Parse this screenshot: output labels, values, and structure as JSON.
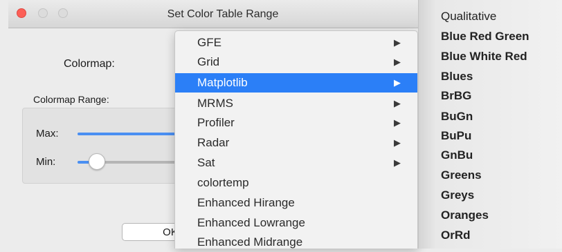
{
  "window": {
    "title": "Set Color Table Range"
  },
  "dialog": {
    "colormap_label": "Colormap:",
    "range_label": "Colormap Range:",
    "max_label": "Max:",
    "min_label": "Min:",
    "ok_label": "OK",
    "max_slider_level": 1.0,
    "min_slider_level": 0.1
  },
  "menu": {
    "items": [
      {
        "label": "GFE",
        "submenu": true
      },
      {
        "label": "Grid",
        "submenu": true
      },
      {
        "label": "Matplotlib",
        "submenu": true,
        "selected": true
      },
      {
        "label": "MRMS",
        "submenu": true
      },
      {
        "label": "Profiler",
        "submenu": true
      },
      {
        "label": "Radar",
        "submenu": true
      },
      {
        "label": "Sat",
        "submenu": true
      },
      {
        "label": "colortemp",
        "submenu": false
      },
      {
        "label": "Enhanced Hirange",
        "submenu": false
      },
      {
        "label": "Enhanced Lowrange",
        "submenu": false
      },
      {
        "label": "Enhanced Midrange",
        "submenu": false
      }
    ],
    "arrow_glyph": "▶"
  },
  "submenu": {
    "items": [
      {
        "label": "Qualitative",
        "submenu": true
      },
      {
        "label": "Blue Red Green"
      },
      {
        "label": "Blue White Red"
      },
      {
        "label": "Blues"
      },
      {
        "label": "BrBG"
      },
      {
        "label": "BuGn"
      },
      {
        "label": "BuPu"
      },
      {
        "label": "GnBu"
      },
      {
        "label": "Greens"
      },
      {
        "label": "Greys"
      },
      {
        "label": "Oranges"
      },
      {
        "label": "OrRd"
      }
    ]
  },
  "colors": {
    "selection": "#2b7ff7",
    "slider_fill": "#4a8ff2",
    "close_button": "#fc5f57"
  }
}
